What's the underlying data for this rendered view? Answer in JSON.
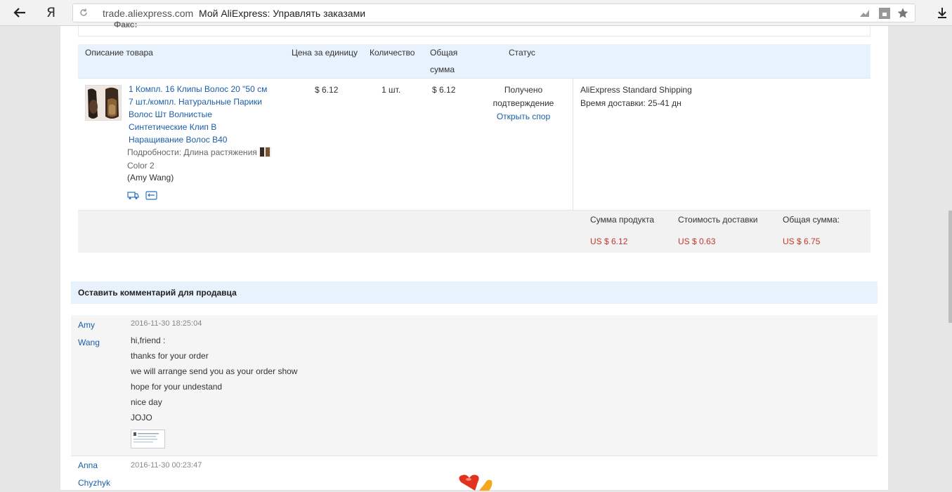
{
  "browser": {
    "url_domain": "trade.aliexpress.com",
    "page_title": "Мой AliExpress: Управлять заказами",
    "logo": "Я"
  },
  "fax_label": "Факс:",
  "table": {
    "headers": {
      "description": "Описание товара",
      "unit_price": "Цена за единицу",
      "quantity": "Количество",
      "total_line1": "Общая",
      "total_line2": "сумма",
      "status": "Статус"
    },
    "item": {
      "title_lines": [
        "1 Компл. 16 Клипы Волос 20 \"50 см",
        "7 шт./компл. Натуральные Парики",
        "Волос Шт Волнистые",
        "Синтетические Клип В",
        "Наращивание Волос B40"
      ],
      "details_line1": "Подробности: Длина растяжения",
      "details_line2": "Color 2",
      "seller": "(Amy Wang)",
      "unit_price": "$ 6.12",
      "quantity": "1 шт.",
      "total": "$ 6.12",
      "status_line1": "Получено",
      "status_line2": "подтверждение",
      "dispute_link": "Открыть спор",
      "shipping_method": "AliExpress Standard Shipping",
      "delivery_label": "Время доставки:",
      "delivery_time": "25-41 дн"
    },
    "summary": {
      "product_label": "Сумма продукта",
      "product_value": "US $ 6.12",
      "shipping_label": "Стоимость доставки",
      "shipping_value": "US $ 0.63",
      "total_label": "Общая сумма:",
      "total_value": "US $ 6.75"
    }
  },
  "comments": {
    "title": "Оставить комментарий для продавца",
    "items": [
      {
        "author_first": "Amy",
        "author_last": "Wang",
        "time": "2016-11-30 18:25:04",
        "lines": [
          "hi,friend :",
          "thanks for your order",
          "we will arrange send you as your order show",
          "hope for your undestand",
          "nice day",
          "JOJO"
        ]
      },
      {
        "author_first": "Anna",
        "author_last": "Chyzhyk",
        "time": "2016-11-30 00:23:47"
      }
    ]
  },
  "icons": {
    "back": "back-arrow-icon",
    "reload": "reload-icon",
    "download": "download-icon"
  }
}
